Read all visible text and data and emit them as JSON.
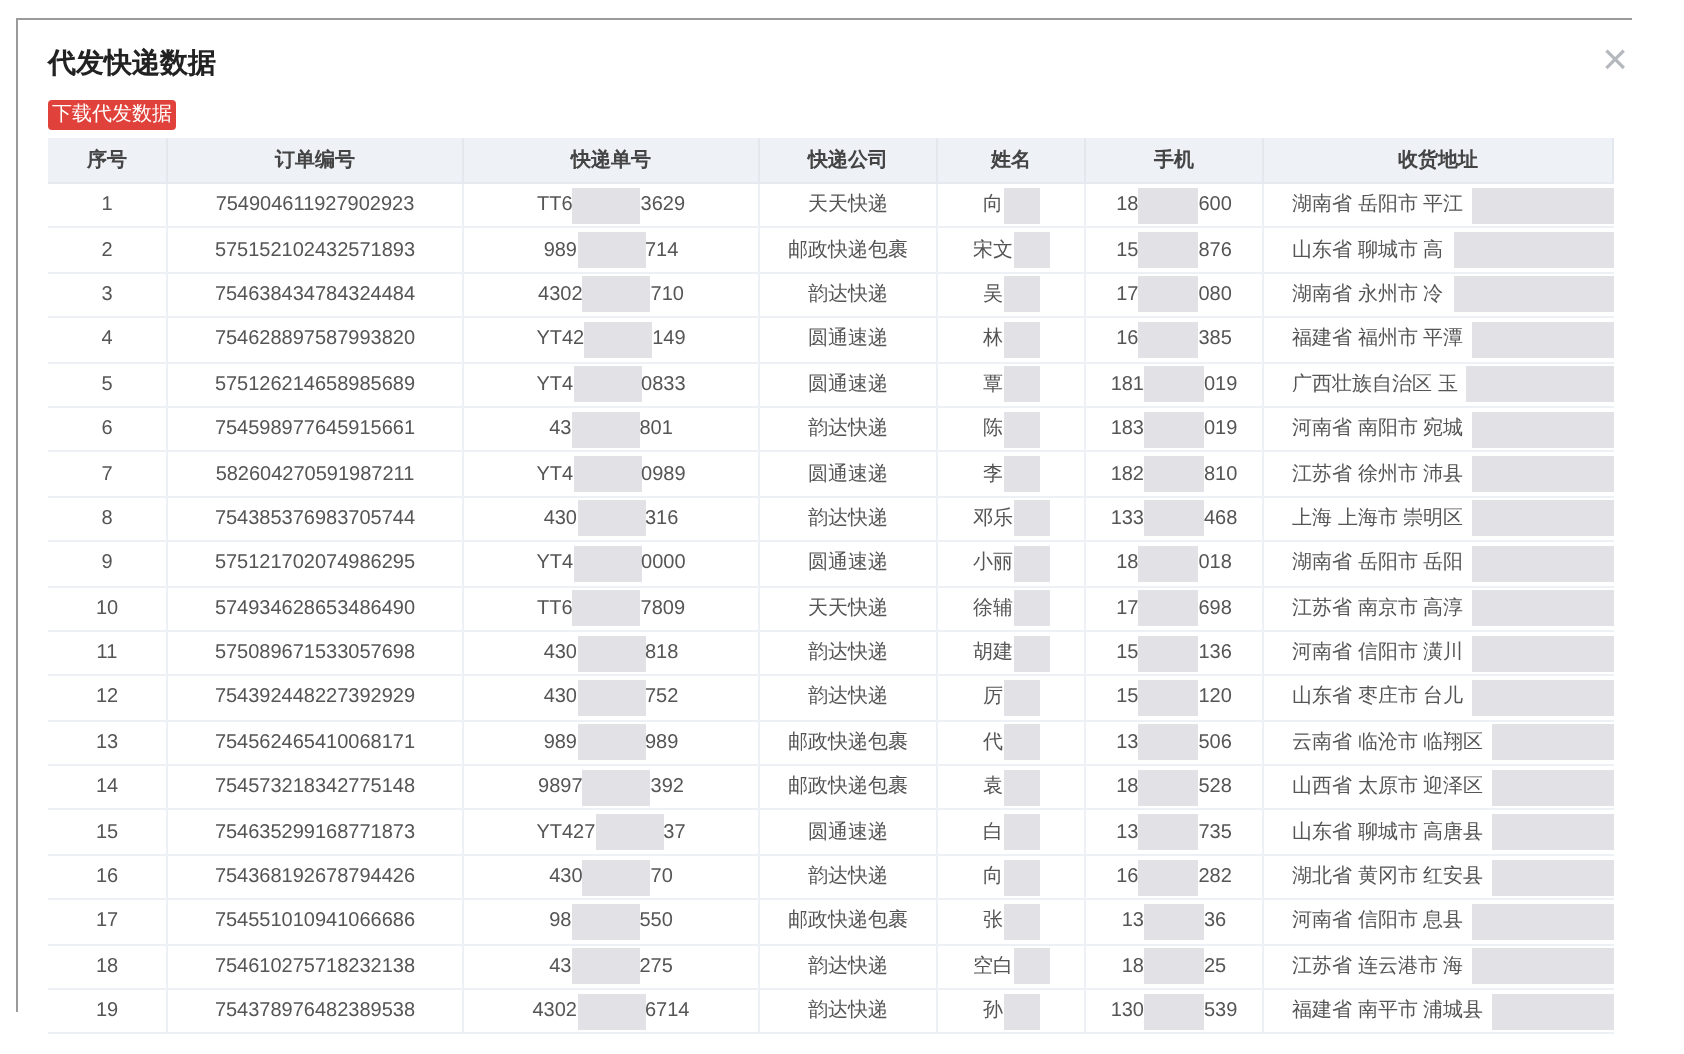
{
  "dialog": {
    "title": "代发快递数据",
    "download_button": "下载代发数据",
    "close": "×"
  },
  "table": {
    "columns": [
      "序号",
      "订单编号",
      "快递单号",
      "快递公司",
      "姓名",
      "手机",
      "收货地址"
    ],
    "rows": [
      {
        "index": "1",
        "order": "754904611927902923",
        "waybill": {
          "start": "TT6",
          "end": "3629"
        },
        "courier": "天天快递",
        "name": "向",
        "phone": {
          "start": "18",
          "end": "600"
        },
        "address": "湖南省 岳阳市 平江"
      },
      {
        "index": "2",
        "order": "575152102432571893",
        "waybill": {
          "start": "989",
          "end": "714"
        },
        "courier": "邮政快递包裹",
        "name": "宋文",
        "phone": {
          "start": "15",
          "end": "876"
        },
        "address": "山东省 聊城市 高"
      },
      {
        "index": "3",
        "order": "754638434784324484",
        "waybill": {
          "start": "4302",
          "end": "710"
        },
        "courier": "韵达快递",
        "name": "吴",
        "phone": {
          "start": "17",
          "end": "080"
        },
        "address": "湖南省 永州市 冷"
      },
      {
        "index": "4",
        "order": "754628897587993820",
        "waybill": {
          "start": "YT42",
          "end": "149"
        },
        "courier": "圆通速递",
        "name": "林",
        "phone": {
          "start": "16",
          "end": "385"
        },
        "address": "福建省 福州市 平潭"
      },
      {
        "index": "5",
        "order": "575126214658985689",
        "waybill": {
          "start": "YT4",
          "end": "0833"
        },
        "courier": "圆通速递",
        "name": "覃",
        "phone": {
          "start": "181",
          "end": "019"
        },
        "address": "广西壮族自治区 玉"
      },
      {
        "index": "6",
        "order": "754598977645915661",
        "waybill": {
          "start": "43",
          "end": "801"
        },
        "courier": "韵达快递",
        "name": "陈",
        "phone": {
          "start": "183",
          "end": "019"
        },
        "address": "河南省 南阳市 宛城"
      },
      {
        "index": "7",
        "order": "582604270591987211",
        "waybill": {
          "start": "YT4",
          "end": "0989"
        },
        "courier": "圆通速递",
        "name": "李",
        "phone": {
          "start": "182",
          "end": "810"
        },
        "address": "江苏省 徐州市 沛县"
      },
      {
        "index": "8",
        "order": "754385376983705744",
        "waybill": {
          "start": "430",
          "end": "316"
        },
        "courier": "韵达快递",
        "name": "邓乐",
        "phone": {
          "start": "133",
          "end": "468"
        },
        "address": "上海 上海市 崇明区"
      },
      {
        "index": "9",
        "order": "575121702074986295",
        "waybill": {
          "start": "YT4",
          "end": "0000"
        },
        "courier": "圆通速递",
        "name": "小丽",
        "phone": {
          "start": "18",
          "end": "018"
        },
        "address": "湖南省 岳阳市 岳阳"
      },
      {
        "index": "10",
        "order": "574934628653486490",
        "waybill": {
          "start": "TT6",
          "end": "7809"
        },
        "courier": "天天快递",
        "name": "徐辅",
        "phone": {
          "start": "17",
          "end": "698"
        },
        "address": "江苏省 南京市 高淳"
      },
      {
        "index": "11",
        "order": "575089671533057698",
        "waybill": {
          "start": "430",
          "end": "818"
        },
        "courier": "韵达快递",
        "name": "胡建",
        "phone": {
          "start": "15",
          "end": "136"
        },
        "address": "河南省 信阳市 潢川"
      },
      {
        "index": "12",
        "order": "754392448227392929",
        "waybill": {
          "start": "430",
          "end": "752"
        },
        "courier": "韵达快递",
        "name": "厉",
        "phone": {
          "start": "15",
          "end": "120"
        },
        "address": "山东省 枣庄市 台儿"
      },
      {
        "index": "13",
        "order": "754562465410068171",
        "waybill": {
          "start": "989",
          "end": "989"
        },
        "courier": "邮政快递包裹",
        "name": "代",
        "phone": {
          "start": "13",
          "end": "506"
        },
        "address": "云南省 临沧市 临翔区"
      },
      {
        "index": "14",
        "order": "754573218342775148",
        "waybill": {
          "start": "9897",
          "end": "392"
        },
        "courier": "邮政快递包裹",
        "name": "袁",
        "phone": {
          "start": "18",
          "end": "528"
        },
        "address": "山西省 太原市 迎泽区"
      },
      {
        "index": "15",
        "order": "754635299168771873",
        "waybill": {
          "start": "YT427",
          "end": "37"
        },
        "courier": "圆通速递",
        "name": "白",
        "phone": {
          "start": "13",
          "end": "735"
        },
        "address": "山东省 聊城市 高唐县"
      },
      {
        "index": "16",
        "order": "754368192678794426",
        "waybill": {
          "start": "430",
          "end": "70"
        },
        "courier": "韵达快递",
        "name": "向",
        "phone": {
          "start": "16",
          "end": "282"
        },
        "address": "湖北省 黄冈市 红安县"
      },
      {
        "index": "17",
        "order": "754551010941066686",
        "waybill": {
          "start": "98",
          "end": "550"
        },
        "courier": "邮政快递包裹",
        "name": "张",
        "phone": {
          "start": "13",
          "end": "36"
        },
        "address": "河南省 信阳市 息县"
      },
      {
        "index": "18",
        "order": "754610275718232138",
        "waybill": {
          "start": "43",
          "end": "275"
        },
        "courier": "韵达快递",
        "name": "空白",
        "phone": {
          "start": "18",
          "end": "25"
        },
        "address": "江苏省 连云港市 海"
      },
      {
        "index": "19",
        "order": "754378976482389538",
        "waybill": {
          "start": "4302",
          "end": "6714"
        },
        "courier": "韵达快递",
        "name": "孙",
        "phone": {
          "start": "130",
          "end": "539"
        },
        "address": "福建省 南平市 浦城县"
      }
    ]
  }
}
